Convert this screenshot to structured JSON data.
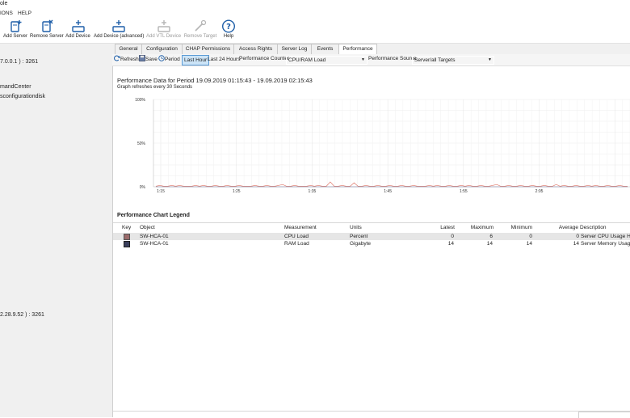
{
  "window": {
    "title": "ole"
  },
  "menu": {
    "items": [
      "IONS",
      "HELP"
    ]
  },
  "toolbar": {
    "buttons": [
      {
        "label": "Add Server",
        "icon": "add-server-icon",
        "enabled": true
      },
      {
        "label": "Remove Server",
        "icon": "remove-server-icon",
        "enabled": true
      },
      {
        "label": "Add Device",
        "icon": "add-device-icon",
        "enabled": true
      },
      {
        "label": "Add Device (advanced)",
        "icon": "add-device-advanced-icon",
        "enabled": true
      },
      {
        "label": "Add VTL Device",
        "icon": "add-vtl-device-icon",
        "enabled": false
      },
      {
        "label": "Remove Target",
        "icon": "remove-target-icon",
        "enabled": false
      },
      {
        "label": "Help",
        "icon": "help-icon",
        "enabled": true
      }
    ]
  },
  "tree": {
    "nodes": [
      "7.0.0.1 ) : 3261",
      "mandCenter",
      "sconfigurationdisk",
      "2.28.9.52 ) : 3261"
    ]
  },
  "tabs": [
    "General",
    "Configuration",
    "CHAP Permissions",
    "Access Rights",
    "Server Log",
    "Events",
    "Performance"
  ],
  "active_tab": "Performance",
  "perfbar": {
    "refresh": "Refresh",
    "save": "Save",
    "period": "Period",
    "last_hour": "Last Hour",
    "last_24h": "Last 24 Hours",
    "counter_label": "Performance Counter",
    "counter_value": "CPU/RAM Load",
    "source_label": "Performance Source",
    "source_value": "Server/all Targets"
  },
  "performance": {
    "title": "Performance Data for Period 19.09.2019 01:15:43 - 19.09.2019 02:15:43",
    "refresh_note": "Graph refreshes every 30 Seconds"
  },
  "chart_data": {
    "type": "line",
    "x": [
      "1:15",
      "1:25",
      "1:35",
      "1:45",
      "1:55",
      "2:05"
    ],
    "ytick_labels": [
      "100%",
      "50%",
      "0%"
    ],
    "ylim": [
      0,
      100
    ],
    "grid": true,
    "series": [
      {
        "name": "",
        "color": "#e07b6e",
        "values": [
          0,
          1,
          0,
          0,
          1,
          0,
          1,
          0,
          0,
          0,
          1,
          0,
          1,
          0,
          0,
          1,
          0,
          0,
          1,
          0,
          0,
          1,
          0,
          0,
          0,
          1,
          0,
          0,
          1,
          0,
          0,
          1,
          2,
          0,
          0,
          1,
          0,
          0,
          0,
          1,
          0,
          1,
          0,
          0,
          5,
          0,
          0,
          1,
          0,
          0,
          4,
          0,
          0,
          1,
          0,
          0,
          1,
          0,
          0,
          1,
          0,
          0,
          1,
          0,
          0,
          1,
          0,
          0,
          0,
          1,
          0,
          1,
          0,
          0,
          1,
          0,
          0,
          1,
          0,
          1,
          0,
          0,
          1,
          0,
          0,
          1,
          2,
          0,
          0,
          1,
          0,
          0,
          1,
          0,
          0,
          1,
          0,
          0,
          1,
          0,
          0,
          2,
          0,
          1,
          0,
          0,
          1,
          0,
          0,
          1,
          0,
          1,
          0,
          0,
          1,
          0,
          0,
          1,
          0,
          0
        ]
      },
      {
        "name": "",
        "color": "#9a9ab4",
        "values": [
          0,
          0,
          0,
          0,
          0,
          0,
          0,
          0,
          0,
          0,
          0,
          0,
          0,
          0,
          0,
          0,
          0,
          0,
          0,
          0,
          0,
          0,
          0,
          0,
          0,
          0,
          0,
          0,
          0,
          0,
          0,
          0,
          0,
          0,
          0,
          0,
          0,
          0,
          0,
          0,
          0,
          0,
          0,
          0,
          0,
          0,
          0,
          0,
          0,
          0,
          0,
          0,
          0,
          0,
          0,
          0,
          0,
          0,
          0,
          0,
          0,
          0,
          0,
          0,
          0,
          0,
          0,
          0,
          0,
          0,
          0,
          0,
          0,
          0,
          0,
          0,
          0,
          0,
          0,
          0,
          0,
          0,
          0,
          0,
          0,
          0,
          0,
          0,
          0,
          0,
          0,
          0,
          0,
          0,
          0,
          0,
          0,
          0,
          0,
          0,
          0,
          0,
          0,
          0,
          0,
          0,
          0,
          0,
          0,
          0,
          0,
          0,
          0,
          0,
          0,
          0,
          0,
          0,
          0,
          0
        ]
      }
    ]
  },
  "legend": {
    "title": "Performance Chart Legend",
    "columns": [
      "Key",
      "Object",
      "Measurement",
      "Units",
      "Latest",
      "Maximum",
      "Minimum",
      "Average",
      "Description"
    ],
    "rows": [
      {
        "key_color": "#9b6b6b",
        "object": "SW-HCA-01",
        "measurement": "CPU Load",
        "units": "Percent",
        "latest": "0",
        "maximum": "6",
        "minimum": "0",
        "average": "0",
        "description": "Server CPU Usage Histo"
      },
      {
        "key_color": "#3a3f5c",
        "object": "SW-HCA-01",
        "measurement": "RAM Load",
        "units": "Gigabyte",
        "latest": "14",
        "maximum": "14",
        "minimum": "14",
        "average": "14",
        "description": "Server Memory Usage H"
      }
    ]
  }
}
